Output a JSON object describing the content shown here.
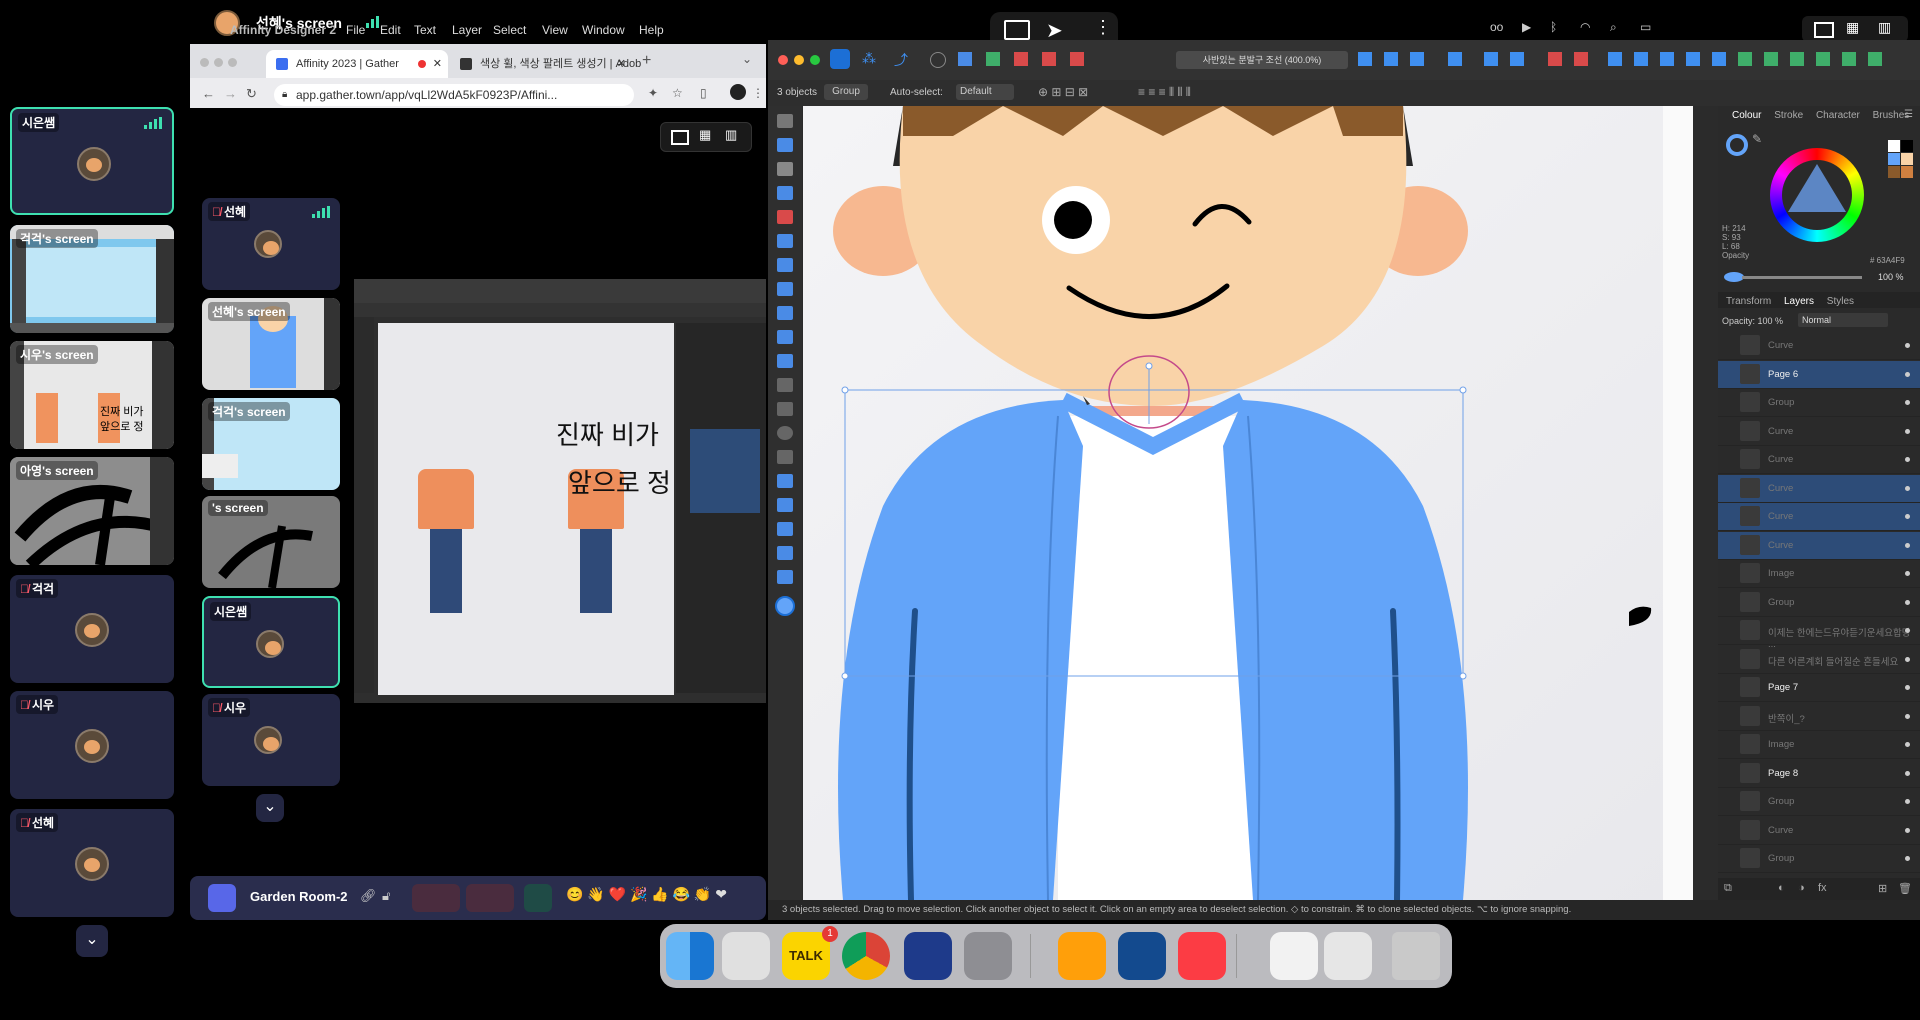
{
  "screen_share_title": "선혜's screen",
  "mac_menu": [
    "Affinity Designer 2",
    "File",
    "Edit",
    "Text",
    "Layer",
    "Select",
    "View",
    "Window",
    "Help"
  ],
  "participants": [
    {
      "name": "시은쌤",
      "type": "avatar",
      "active": true
    },
    {
      "name": "걱걱's screen",
      "type": "screen"
    },
    {
      "name": "시우's screen",
      "type": "screen"
    },
    {
      "name": "아영's screen",
      "type": "screen"
    },
    {
      "name": "걱걱",
      "type": "avatar"
    },
    {
      "name": "시우",
      "type": "avatar"
    },
    {
      "name": "선혜",
      "type": "avatar"
    }
  ],
  "participants_mid": [
    {
      "name": "선혜",
      "type": "avatar"
    },
    {
      "name": "선혜's screen",
      "type": "screen"
    },
    {
      "name": "걱걱's screen",
      "type": "screen"
    },
    {
      "name": "'s screen",
      "type": "screen"
    },
    {
      "name": "시은쌤",
      "type": "avatar",
      "active": true
    },
    {
      "name": "시우",
      "type": "avatar"
    }
  ],
  "browser": {
    "tab1": "Affinity 2023 | Gather",
    "tab2": "색상 휠, 색상 팔레트 생성기 | Adob",
    "url": "app.gather.town/app/vqLl2WdA5kF0923P/Affini..."
  },
  "mini_screen": {
    "text_line1": "진짜 비가",
    "text_line2": "앞으로 정"
  },
  "mini_thumb_text": {
    "line1": "진짜 비가",
    "line2": "앞으로 정"
  },
  "gather_toolbar": {
    "room": "Garden Room-2"
  },
  "affinity": {
    "context": {
      "count": "3 objects",
      "group": "Group",
      "autoselect": "Auto-select:",
      "mode": "Default",
      "zoom_field": "사반있는 분발구 조선 (400.0%)"
    },
    "panel_tabs_top": [
      "Colour",
      "Stroke",
      "Character",
      "Brushes"
    ],
    "colour": {
      "h": "H: 214",
      "s": "S: 93",
      "l": "L: 68",
      "opacity_label": "Opacity",
      "opacity_value": "100 %",
      "hex": "# 63A4F9"
    },
    "panel_tabs_mid": [
      "Transform",
      "Layers",
      "Styles"
    ],
    "layers_opacity": "Opacity: 100 %",
    "blend_mode": "Normal",
    "layers": [
      {
        "name": "Curve",
        "sel": false,
        "page": false
      },
      {
        "name": "Page 6",
        "sel": true,
        "page": true
      },
      {
        "name": "Group",
        "sel": false,
        "page": false
      },
      {
        "name": "Curve",
        "sel": false,
        "page": false
      },
      {
        "name": "Curve",
        "sel": false,
        "page": false
      },
      {
        "name": "Curve",
        "sel": true,
        "page": false
      },
      {
        "name": "Curve",
        "sel": true,
        "page": false
      },
      {
        "name": "Curve",
        "sel": true,
        "page": false
      },
      {
        "name": "Image",
        "sel": false,
        "page": false
      },
      {
        "name": "Group",
        "sel": false,
        "page": false
      },
      {
        "name": "이제는 한에는드유야듣기운세요합당 ...",
        "sel": false,
        "page": false
      },
      {
        "name": "다른 어른계회 들어질순 흔들세요",
        "sel": false,
        "page": false
      },
      {
        "name": "Page 7",
        "sel": false,
        "page": true
      },
      {
        "name": "반쪽이_?",
        "sel": false,
        "page": false
      },
      {
        "name": "Image",
        "sel": false,
        "page": false
      },
      {
        "name": "Page 8",
        "sel": false,
        "page": true
      },
      {
        "name": "Group",
        "sel": false,
        "page": false
      },
      {
        "name": "Curve",
        "sel": false,
        "page": false
      },
      {
        "name": "Group",
        "sel": false,
        "page": false
      }
    ],
    "status": "3 objects selected. Drag to move selection. Click another object to select it. Click on an empty area to deselect selection. ◇ to constrain. ⌘ to clone selected objects. ⌥ to ignore snapping."
  },
  "dock_badge": "1",
  "colors": {
    "jacket": "#63a4f9",
    "skin": "#f9d3a8",
    "hair": "#8a5a2b",
    "gather_bg": "#232642",
    "accent": "#3ee0b0"
  }
}
